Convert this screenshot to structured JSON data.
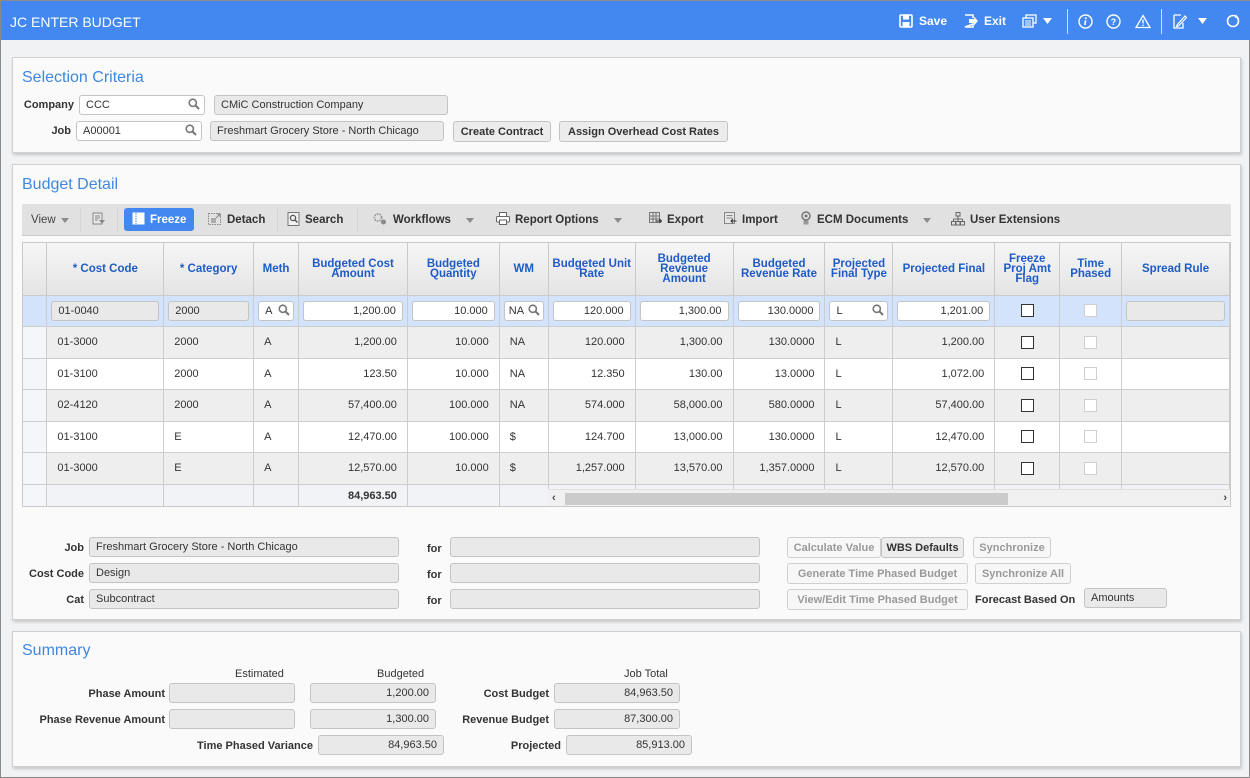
{
  "header": {
    "title": "JC ENTER BUDGET",
    "save_label": "Save",
    "exit_label": "Exit",
    "icons": [
      "save-icon",
      "exit-icon",
      "copy-stack-icon",
      "info-icon",
      "help-icon",
      "warning-icon",
      "edit-note-icon",
      "refresh-icon"
    ]
  },
  "selection": {
    "title": "Selection Criteria",
    "company_label": "Company",
    "company_value": "CCC",
    "company_name": "CMiC Construction Company",
    "job_label": "Job",
    "job_value": "A00001",
    "job_name": "Freshmart Grocery Store -  North Chicago",
    "create_contract": "Create Contract",
    "assign_overhead": "Assign Overhead Cost Rates"
  },
  "budget": {
    "title": "Budget Detail",
    "toolbar": {
      "view": "View",
      "freeze": "Freeze",
      "detach": "Detach",
      "search": "Search",
      "workflows": "Workflows",
      "report_options": "Report Options",
      "export": "Export",
      "import": "Import",
      "ecm_documents": "ECM Documents",
      "user_extensions": "User Extensions"
    },
    "columns": [
      "* Cost Code",
      "* Category",
      "Meth",
      "Budgeted Cost Amount",
      "Budgeted Quantity",
      "WM",
      "Budgeted Unit Rate",
      "Budgeted Revenue Amount",
      "Budgeted Revenue Rate",
      "Projected Final Type",
      "Projected Final",
      "Freeze Proj Amt Flag",
      "Time Phased",
      "Spread Rule"
    ],
    "edit_row": {
      "cost_code": "01-0040",
      "category": "2000",
      "meth": "A",
      "cost_amount": "1,200.00",
      "quantity": "10.000",
      "wm": "NA",
      "unit_rate": "120.000",
      "revenue_amount": "1,300.00",
      "revenue_rate": "130.0000",
      "proj_final_type": "L",
      "proj_final": "1,201.00",
      "freeze_flag": false,
      "time_phased": false,
      "spread_rule": ""
    },
    "rows": [
      {
        "cost_code": "01-3000",
        "category": "2000",
        "meth": "A",
        "cost_amount": "1,200.00",
        "quantity": "10.000",
        "wm": "NA",
        "unit_rate": "120.000",
        "revenue_amount": "1,300.00",
        "revenue_rate": "130.0000",
        "proj_final_type": "L",
        "proj_final": "1,200.00",
        "freeze_flag": false,
        "time_phased": false,
        "spread_rule": ""
      },
      {
        "cost_code": "01-3100",
        "category": "2000",
        "meth": "A",
        "cost_amount": "123.50",
        "quantity": "10.000",
        "wm": "NA",
        "unit_rate": "12.350",
        "revenue_amount": "130.00",
        "revenue_rate": "13.0000",
        "proj_final_type": "L",
        "proj_final": "1,072.00",
        "freeze_flag": false,
        "time_phased": false,
        "spread_rule": ""
      },
      {
        "cost_code": "02-4120",
        "category": "2000",
        "meth": "A",
        "cost_amount": "57,400.00",
        "quantity": "100.000",
        "wm": "NA",
        "unit_rate": "574.000",
        "revenue_amount": "58,000.00",
        "revenue_rate": "580.0000",
        "proj_final_type": "L",
        "proj_final": "57,400.00",
        "freeze_flag": false,
        "time_phased": false,
        "spread_rule": ""
      },
      {
        "cost_code": "01-3100",
        "category": "E",
        "meth": "A",
        "cost_amount": "12,470.00",
        "quantity": "100.000",
        "wm": "$",
        "unit_rate": "124.700",
        "revenue_amount": "13,000.00",
        "revenue_rate": "130.0000",
        "proj_final_type": "L",
        "proj_final": "12,470.00",
        "freeze_flag": false,
        "time_phased": false,
        "spread_rule": ""
      },
      {
        "cost_code": "01-3000",
        "category": "E",
        "meth": "A",
        "cost_amount": "12,570.00",
        "quantity": "10.000",
        "wm": "$",
        "unit_rate": "1,257.000",
        "revenue_amount": "13,570.00",
        "revenue_rate": "1,357.0000",
        "proj_final_type": "L",
        "proj_final": "12,570.00",
        "freeze_flag": false,
        "time_phased": false,
        "spread_rule": ""
      }
    ],
    "totals": {
      "cost_amount": "84,963.50",
      "revenue_amount": "87,300.00",
      "proj_final": "85,913.00"
    }
  },
  "detail": {
    "job_label": "Job",
    "job_value": "Freshmart Grocery Store -  North Chicago",
    "cost_code_label": "Cost Code",
    "cost_code_value": "Design",
    "cat_label": "Cat",
    "cat_value": "Subcontract",
    "for_label": "for",
    "for_values": [
      "",
      "",
      ""
    ],
    "calculate_value": "Calculate Value",
    "wbs_defaults": "WBS Defaults",
    "synchronize": "Synchronize",
    "generate_tpb": "Generate Time Phased Budget",
    "synchronize_all": "Synchronize All",
    "view_edit_tpb": "View/Edit Time Phased Budget",
    "forecast_label": "Forecast Based On",
    "forecast_value": "Amounts"
  },
  "summary": {
    "title": "Summary",
    "estimated_header": "Estimated",
    "budgeted_header": "Budgeted",
    "job_total_header": "Job Total",
    "phase_amount_label": "Phase Amount",
    "phase_amount_estimated": "",
    "phase_amount_budgeted": "1,200.00",
    "phase_revenue_label": "Phase Revenue Amount",
    "phase_revenue_estimated": "",
    "phase_revenue_budgeted": "1,300.00",
    "time_phased_variance_label": "Time Phased Variance",
    "time_phased_variance": "84,963.50",
    "cost_budget_label": "Cost Budget",
    "cost_budget": "84,963.50",
    "revenue_budget_label": "Revenue Budget",
    "revenue_budget": "87,300.00",
    "projected_label": "Projected",
    "projected": "85,913.00"
  }
}
